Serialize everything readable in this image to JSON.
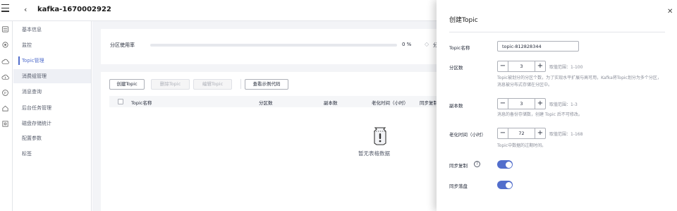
{
  "header": {
    "instance_name": "kafka-1670002922"
  },
  "rail": {
    "icons": [
      "cloud-server-icon",
      "cluster-icon",
      "cloud-icon",
      "network-cloud-icon",
      "monitor-icon",
      "home-icon",
      "settings-target-icon"
    ]
  },
  "sidebar": {
    "items": [
      {
        "label": "基本信息"
      },
      {
        "label": "监控"
      },
      {
        "label": "Topic管理"
      },
      {
        "label": "消费组管理"
      },
      {
        "label": "消息查询"
      },
      {
        "label": "后台任务管理"
      },
      {
        "label": "磁盘存储统计"
      },
      {
        "label": "配置参数"
      },
      {
        "label": "标签"
      }
    ],
    "active_index": 2
  },
  "usage": {
    "label": "分区使用率",
    "percent": 0,
    "percent_text": "0 %",
    "sync_label": "分区..."
  },
  "toolbar": {
    "create": "创建Topic",
    "delete": "删除Topic",
    "edit": "编辑Topic",
    "sample": "查看示例代码"
  },
  "table": {
    "headers": [
      "Topic名称",
      "分区数",
      "副本数",
      "老化时间（小时）",
      "同步复制"
    ],
    "empty_text": "暂无表格数据"
  },
  "drawer": {
    "title": "创建Topic",
    "topic_name": {
      "label": "Topic名称",
      "value": "topic-812828344"
    },
    "partitions": {
      "label": "分区数",
      "value": "3",
      "range": "取值范围：1-100",
      "hint": "Topic被划分的分区个数，为了实现水平扩展与高可用，Kafka将Topic划分为多个分区，消息被分布式存储在分区中。"
    },
    "replicas": {
      "label": "副本数",
      "value": "3",
      "range": "取值范围：1-3",
      "hint": "消息的备份存储数，创建 Topic 后不可修改。"
    },
    "aging": {
      "label": "老化时间（小时）",
      "value": "72",
      "range": "取值范围：1-168",
      "hint": "Topic中数据的过期时间。"
    },
    "sync_replication": {
      "label": "同步复制",
      "on": true
    },
    "sync_flush": {
      "label": "同步落盘",
      "on": true
    }
  },
  "colors": {
    "accent": "#526ecc",
    "text": "#252b3a",
    "muted": "#8a8e99"
  }
}
